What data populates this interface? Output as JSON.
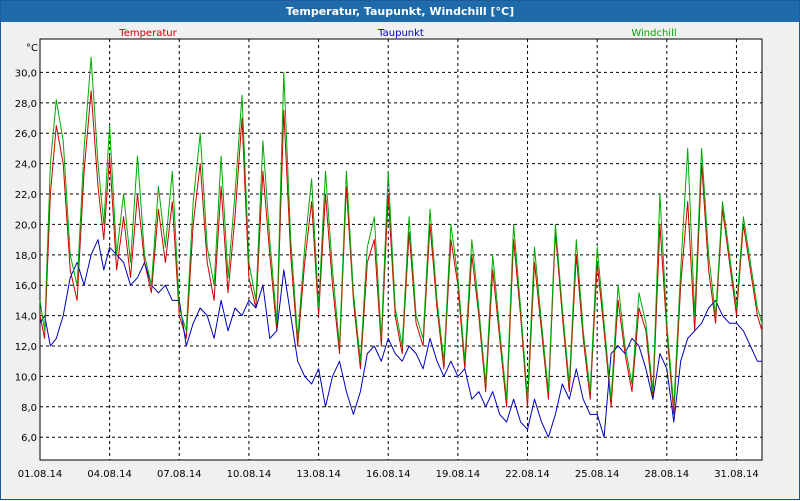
{
  "window": {
    "title": "Temperatur, Taupunkt, Windchill [°C]"
  },
  "colors": {
    "titlebar": "#1f6aa8",
    "plot_background": "#ffffff",
    "grid": "#000000",
    "temperatur": "#cc0000",
    "taupunkt": "#0000bb",
    "windchill": "#00aa00"
  },
  "chart_data": {
    "type": "line",
    "title": "Temperatur, Taupunkt, Windchill [°C]",
    "ylabel": "°C",
    "xlabel": "",
    "ylim": [
      4.5,
      32.2
    ],
    "xlim": [
      0,
      31.1
    ],
    "y_ticks": [
      "6,0",
      "8,0",
      "10,0",
      "12,0",
      "14,0",
      "16,0",
      "18,0",
      "20,0",
      "22,0",
      "24,0",
      "26,0",
      "28,0",
      "30,0"
    ],
    "y_tick_values": [
      6,
      8,
      10,
      12,
      14,
      16,
      18,
      20,
      22,
      24,
      26,
      28,
      30
    ],
    "x_ticks": [
      "01.08.14",
      "04.08.14",
      "07.08.14",
      "10.08.14",
      "13.08.14",
      "16.08.14",
      "19.08.14",
      "22.08.14",
      "25.08.14",
      "28.08.14",
      "31.08.14"
    ],
    "x_tick_values": [
      0,
      3,
      6,
      9,
      12,
      15,
      18,
      21,
      24,
      27,
      30
    ],
    "grid": true,
    "legend_position": "top",
    "series": [
      {
        "name": "Temperatur",
        "x": [
          0.0,
          0.2,
          0.45,
          0.7,
          1.0,
          1.3,
          1.6,
          1.9,
          2.2,
          2.5,
          2.75,
          3.0,
          3.3,
          3.6,
          3.9,
          4.2,
          4.5,
          4.8,
          5.1,
          5.4,
          5.7,
          6.0,
          6.3,
          6.6,
          6.9,
          7.2,
          7.5,
          7.8,
          8.1,
          8.4,
          8.7,
          9.0,
          9.3,
          9.6,
          9.9,
          10.2,
          10.5,
          10.8,
          11.1,
          11.4,
          11.7,
          12.0,
          12.3,
          12.6,
          12.9,
          13.2,
          13.5,
          13.8,
          14.1,
          14.4,
          14.7,
          15.0,
          15.3,
          15.6,
          15.9,
          16.2,
          16.5,
          16.8,
          17.1,
          17.4,
          17.7,
          18.0,
          18.3,
          18.6,
          18.9,
          19.2,
          19.5,
          19.8,
          20.1,
          20.4,
          20.7,
          21.0,
          21.3,
          21.6,
          21.9,
          22.2,
          22.5,
          22.8,
          23.1,
          23.4,
          23.7,
          24.0,
          24.3,
          24.6,
          24.9,
          25.2,
          25.5,
          25.8,
          26.1,
          26.4,
          26.7,
          27.0,
          27.3,
          27.6,
          27.9,
          28.2,
          28.5,
          28.8,
          29.1,
          29.4,
          29.7,
          30.0,
          30.3,
          30.6,
          30.9,
          31.1
        ],
        "y": [
          14.0,
          12.5,
          22.0,
          26.5,
          24.0,
          17.0,
          15.0,
          23.5,
          28.8,
          22.5,
          19.0,
          24.5,
          17.0,
          20.5,
          16.5,
          22.0,
          17.5,
          15.5,
          21.0,
          17.5,
          21.5,
          14.0,
          12.5,
          20.0,
          24.0,
          17.5,
          15.0,
          22.5,
          15.5,
          20.5,
          27.0,
          16.5,
          14.5,
          23.5,
          18.0,
          13.0,
          27.5,
          18.0,
          12.0,
          17.5,
          21.5,
          14.0,
          22.0,
          16.0,
          11.5,
          22.5,
          15.0,
          10.5,
          17.5,
          19.0,
          12.0,
          22.0,
          14.0,
          11.5,
          19.5,
          13.5,
          12.0,
          20.0,
          14.5,
          10.5,
          19.0,
          16.0,
          10.5,
          18.0,
          14.0,
          9.0,
          17.0,
          12.5,
          8.0,
          19.0,
          14.0,
          8.0,
          17.5,
          13.0,
          8.5,
          19.5,
          14.0,
          9.0,
          18.0,
          12.5,
          8.5,
          17.5,
          13.0,
          8.0,
          15.0,
          11.5,
          9.0,
          14.5,
          13.0,
          8.5,
          20.0,
          13.0,
          7.5,
          16.0,
          21.5,
          13.0,
          24.0,
          17.0,
          13.5,
          21.0,
          17.5,
          14.0,
          20.0,
          17.0,
          14.0,
          13.0
        ],
        "color": "#cc0000"
      },
      {
        "name": "Taupunkt",
        "x": [
          0.0,
          0.2,
          0.45,
          0.7,
          1.0,
          1.3,
          1.6,
          1.9,
          2.2,
          2.5,
          2.75,
          3.0,
          3.3,
          3.6,
          3.9,
          4.2,
          4.5,
          4.8,
          5.1,
          5.4,
          5.7,
          6.0,
          6.3,
          6.6,
          6.9,
          7.2,
          7.5,
          7.8,
          8.1,
          8.4,
          8.7,
          9.0,
          9.3,
          9.6,
          9.9,
          10.2,
          10.5,
          10.8,
          11.1,
          11.4,
          11.7,
          12.0,
          12.3,
          12.6,
          12.9,
          13.2,
          13.5,
          13.8,
          14.1,
          14.4,
          14.7,
          15.0,
          15.3,
          15.6,
          15.9,
          16.2,
          16.5,
          16.8,
          17.1,
          17.4,
          17.7,
          18.0,
          18.3,
          18.6,
          18.9,
          19.2,
          19.5,
          19.8,
          20.1,
          20.4,
          20.7,
          21.0,
          21.3,
          21.6,
          21.9,
          22.2,
          22.5,
          22.8,
          23.1,
          23.4,
          23.7,
          24.0,
          24.3,
          24.6,
          24.9,
          25.2,
          25.5,
          25.8,
          26.1,
          26.4,
          26.7,
          27.0,
          27.3,
          27.6,
          27.9,
          28.2,
          28.5,
          28.8,
          29.1,
          29.4,
          29.7,
          30.0,
          30.3,
          30.6,
          30.9,
          31.1
        ],
        "y": [
          13.5,
          14.0,
          12.0,
          12.5,
          14.0,
          16.5,
          17.5,
          16.0,
          18.0,
          19.0,
          17.0,
          18.5,
          18.0,
          17.5,
          16.0,
          16.5,
          17.5,
          16.0,
          15.5,
          16.0,
          15.0,
          15.0,
          12.0,
          13.5,
          14.5,
          14.0,
          12.5,
          15.0,
          13.0,
          14.5,
          14.0,
          15.0,
          14.5,
          16.0,
          12.5,
          13.0,
          17.0,
          14.0,
          11.0,
          10.0,
          9.5,
          10.5,
          8.0,
          10.0,
          11.0,
          9.0,
          7.5,
          9.0,
          11.5,
          12.0,
          11.0,
          12.5,
          11.5,
          11.0,
          12.0,
          11.5,
          10.5,
          12.5,
          11.0,
          10.0,
          11.0,
          10.0,
          10.5,
          8.5,
          9.0,
          8.0,
          9.0,
          7.5,
          7.0,
          8.5,
          7.0,
          6.5,
          8.5,
          7.0,
          6.0,
          7.5,
          9.5,
          8.5,
          10.5,
          8.5,
          7.5,
          7.5,
          6.0,
          11.5,
          12.0,
          11.5,
          12.5,
          12.0,
          10.5,
          8.5,
          11.5,
          10.5,
          7.0,
          11.0,
          12.5,
          13.0,
          13.5,
          14.5,
          15.0,
          14.0,
          13.5,
          13.5,
          13.0,
          12.0,
          11.0,
          11.0
        ],
        "color": "#0000bb"
      },
      {
        "name": "Windchill",
        "x": [
          0.0,
          0.2,
          0.45,
          0.7,
          1.0,
          1.3,
          1.6,
          1.9,
          2.2,
          2.5,
          2.75,
          3.0,
          3.3,
          3.6,
          3.9,
          4.2,
          4.5,
          4.8,
          5.1,
          5.4,
          5.7,
          6.0,
          6.3,
          6.6,
          6.9,
          7.2,
          7.5,
          7.8,
          8.1,
          8.4,
          8.7,
          9.0,
          9.3,
          9.6,
          9.9,
          10.2,
          10.5,
          10.8,
          11.1,
          11.4,
          11.7,
          12.0,
          12.3,
          12.6,
          12.9,
          13.2,
          13.5,
          13.8,
          14.1,
          14.4,
          14.7,
          15.0,
          15.3,
          15.6,
          15.9,
          16.2,
          16.5,
          16.8,
          17.1,
          17.4,
          17.7,
          18.0,
          18.3,
          18.6,
          18.9,
          19.2,
          19.5,
          19.8,
          20.1,
          20.4,
          20.7,
          21.0,
          21.3,
          21.6,
          21.9,
          22.2,
          22.5,
          22.8,
          23.1,
          23.4,
          23.7,
          24.0,
          24.3,
          24.6,
          24.9,
          25.2,
          25.5,
          25.8,
          26.1,
          26.4,
          26.7,
          27.0,
          27.3,
          27.6,
          27.9,
          28.2,
          28.5,
          28.8,
          29.1,
          29.4,
          29.7,
          30.0,
          30.3,
          30.6,
          30.9,
          31.1
        ],
        "y": [
          15.0,
          13.0,
          24.0,
          28.2,
          25.5,
          18.0,
          16.0,
          25.0,
          31.0,
          24.0,
          20.0,
          26.5,
          18.0,
          22.0,
          17.5,
          24.5,
          18.0,
          16.0,
          22.5,
          18.5,
          23.5,
          14.5,
          13.0,
          21.5,
          26.0,
          18.5,
          16.0,
          24.5,
          16.5,
          22.0,
          28.5,
          17.5,
          15.0,
          25.5,
          19.0,
          13.5,
          30.0,
          19.0,
          12.5,
          18.5,
          23.0,
          14.5,
          23.5,
          17.0,
          12.0,
          23.5,
          15.5,
          11.0,
          18.5,
          20.5,
          12.5,
          23.5,
          14.5,
          12.0,
          20.5,
          14.0,
          12.5,
          21.0,
          15.0,
          11.0,
          20.0,
          16.5,
          11.0,
          19.0,
          14.5,
          9.5,
          18.0,
          13.0,
          8.5,
          20.0,
          14.5,
          8.5,
          18.5,
          13.5,
          9.0,
          20.0,
          14.5,
          9.5,
          19.0,
          13.0,
          9.0,
          18.5,
          13.5,
          8.5,
          16.0,
          12.0,
          9.5,
          15.5,
          13.5,
          9.0,
          22.0,
          13.5,
          8.0,
          17.0,
          25.0,
          14.0,
          25.0,
          18.0,
          14.0,
          21.5,
          18.0,
          14.5,
          20.5,
          17.5,
          14.5,
          13.5
        ],
        "color": "#00aa00"
      }
    ]
  }
}
